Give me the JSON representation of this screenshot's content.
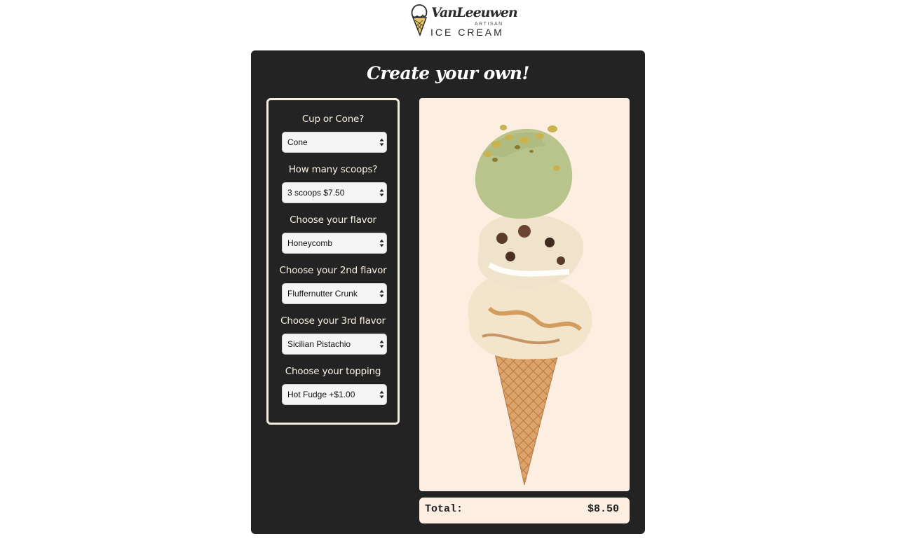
{
  "header": {
    "logo_script": "VanLeeuwen",
    "logo_sub": "ARTISAN",
    "logo_main": "ICE CREAM"
  },
  "builder": {
    "title": "Create your own!",
    "fields": [
      {
        "label": "Cup or Cone?",
        "value": "Cone"
      },
      {
        "label": "How many scoops?",
        "value": "3 scoops $7.50"
      },
      {
        "label": "Choose your flavor",
        "value": "Honeycomb"
      },
      {
        "label": "Choose your 2nd flavor",
        "value": "Fluffernutter Crunk"
      },
      {
        "label": "Choose your 3rd flavor",
        "value": "Sicilian Pistachio"
      },
      {
        "label": "Choose your topping",
        "value": "Hot Fudge +$1.00"
      }
    ]
  },
  "summary": {
    "total_label": "Total:",
    "total_value": "$8.50"
  },
  "icons": {
    "logo": "ice-cream-cone-logo-icon",
    "select_arrows": "updown-arrows-icon",
    "photo": "ice-cream-cone-image"
  },
  "colors": {
    "panel_bg": "#232323",
    "cream": "#fcefe2",
    "border": "#f6eee0",
    "text_light": "#ffffff"
  }
}
